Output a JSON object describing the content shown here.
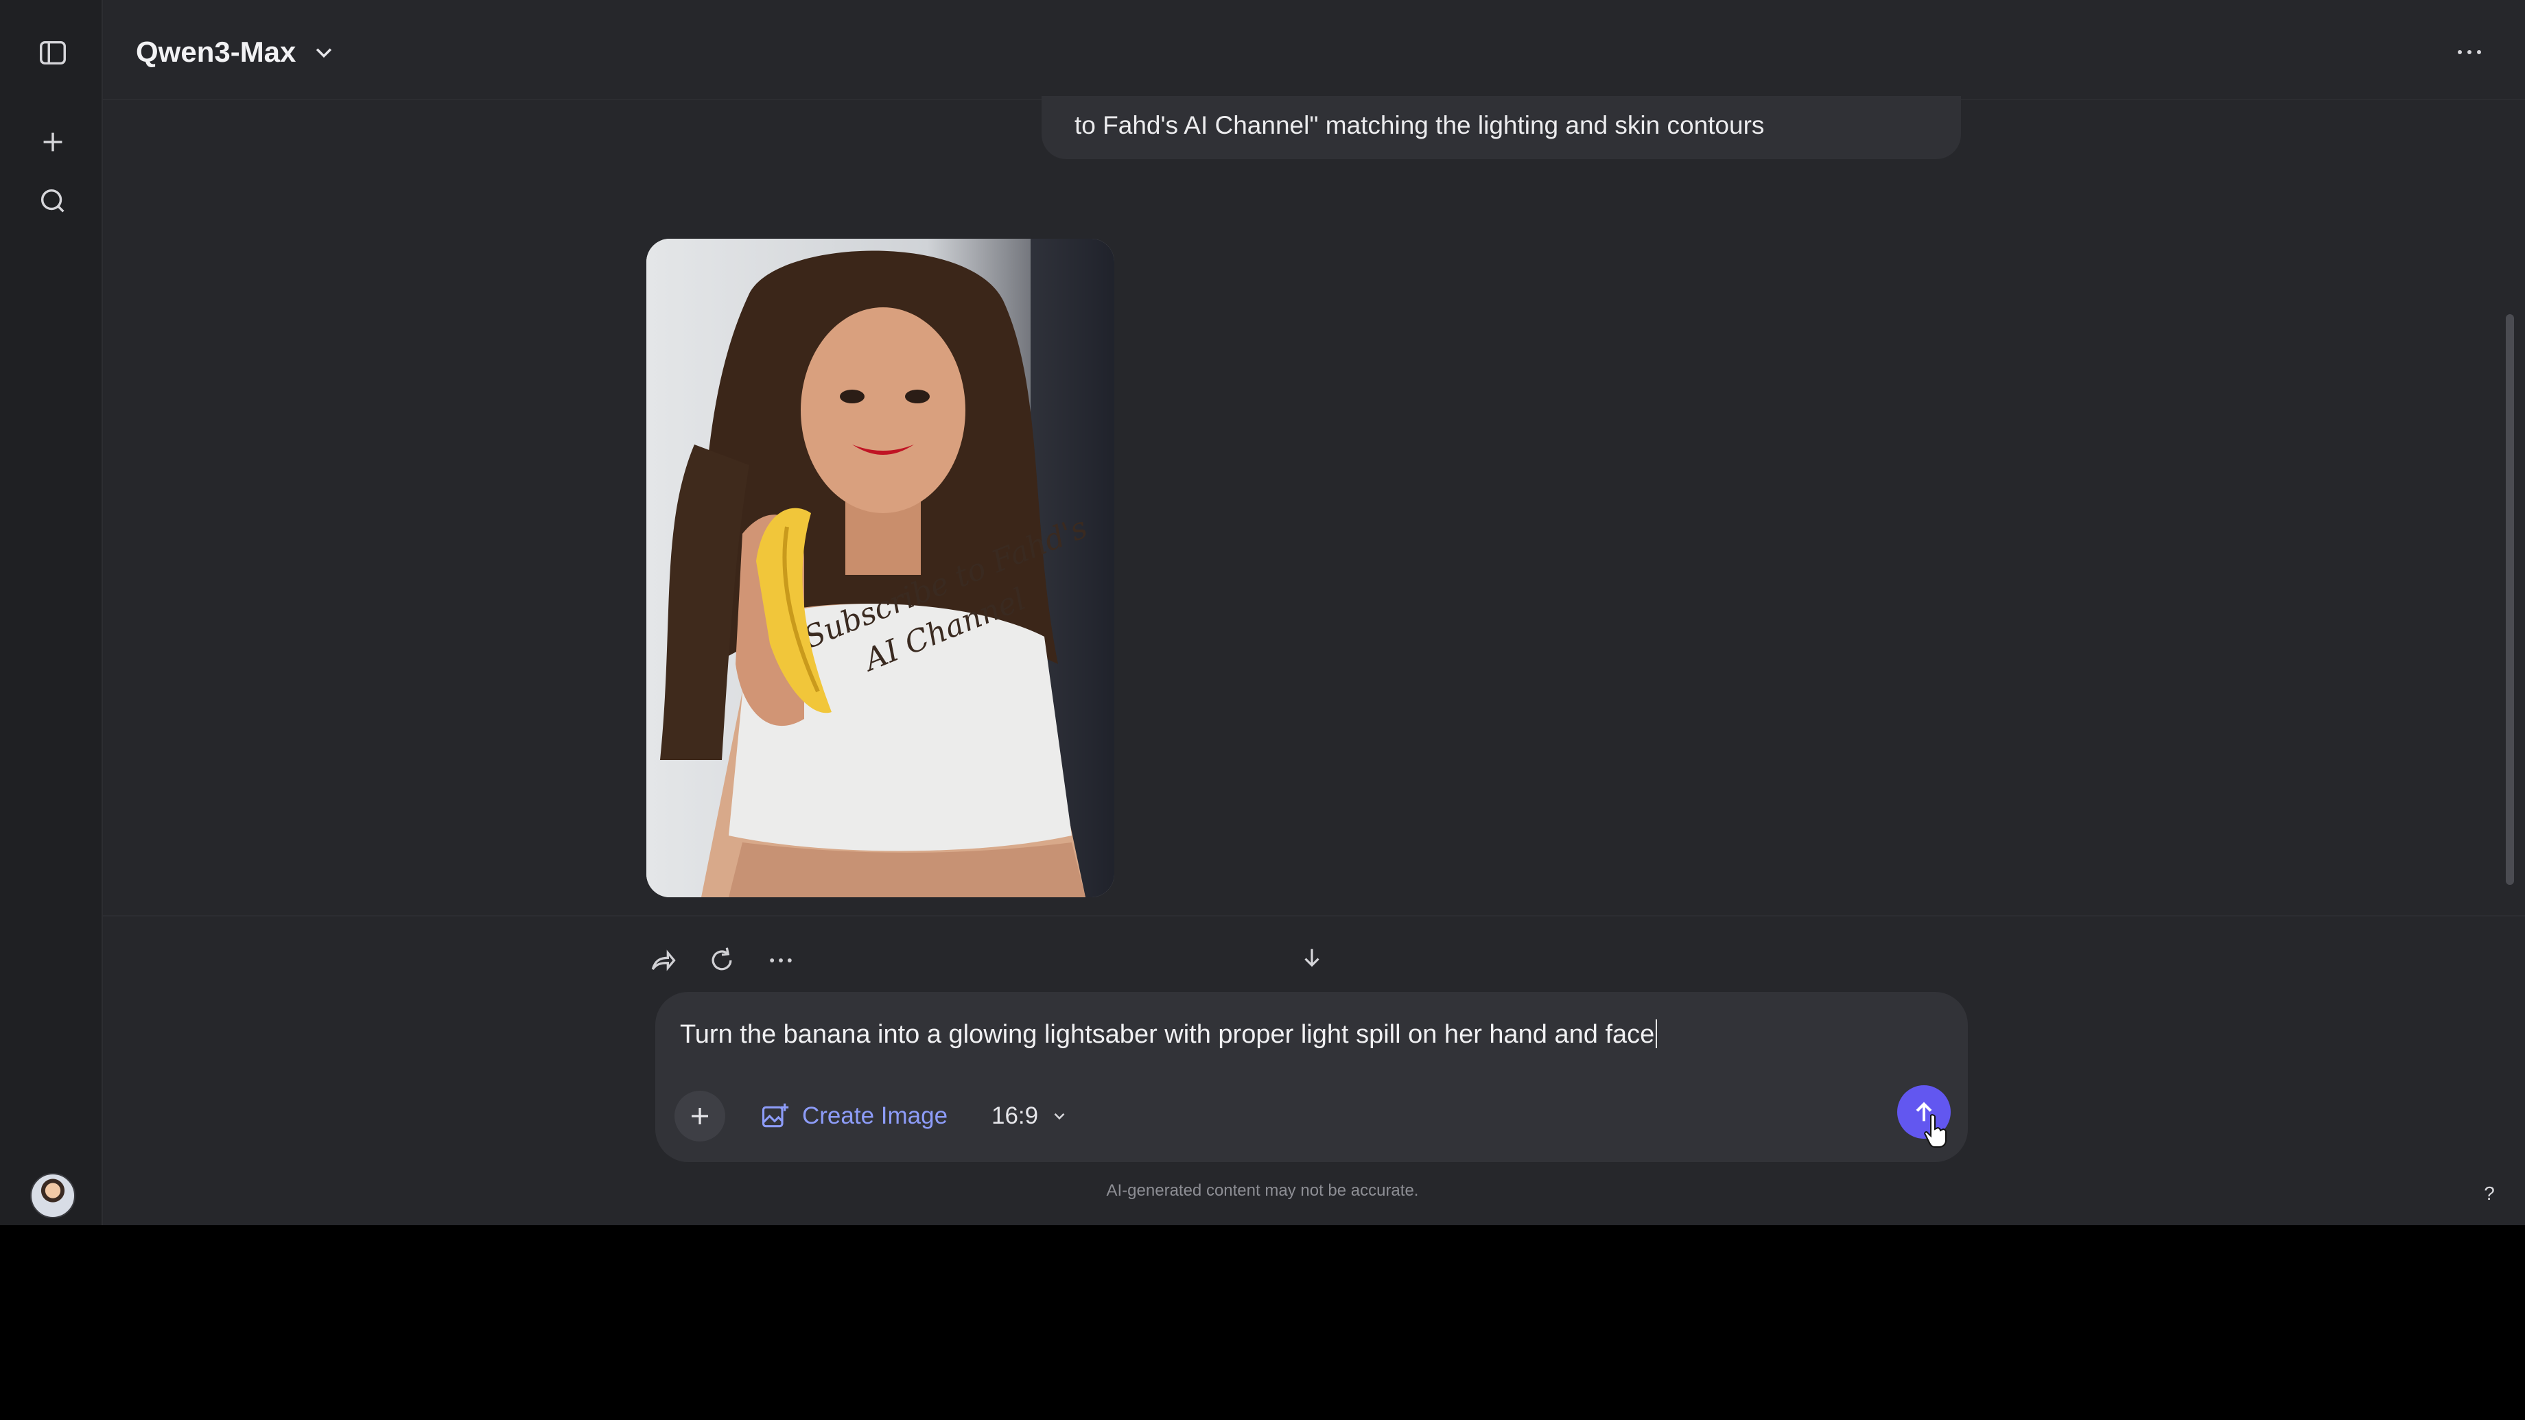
{
  "header": {
    "model_name": "Qwen3-Max"
  },
  "sidebar": {
    "items": [
      {
        "name": "toggle-sidebar",
        "icon": "sidebar-panel-icon"
      },
      {
        "name": "new-chat",
        "icon": "plus-icon"
      },
      {
        "name": "search",
        "icon": "search-icon"
      }
    ]
  },
  "conversation": {
    "user_message": "to Fahd's AI Channel\" matching the lighting and skin contours",
    "image_overlay_text": [
      "Subscribe to Fahd's",
      "AI Channel"
    ]
  },
  "composer": {
    "prompt": "Turn the banana into a glowing lightsaber with proper light spill on her hand and face",
    "create_image_label": "Create Image",
    "aspect_ratio": "16:9"
  },
  "footer": {
    "disclaimer": "AI-generated content may not be accurate.",
    "help_label": "?"
  },
  "colors": {
    "background": "#26272b",
    "sidebar": "#1f2023",
    "accent": "#6257f0",
    "link": "#8d9cf8"
  }
}
